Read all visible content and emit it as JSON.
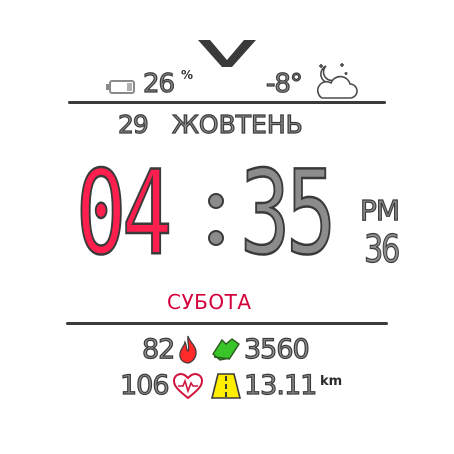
{
  "top": {
    "logo_icon": "w-logo-icon",
    "battery_percent": "26",
    "battery_unit": "%",
    "battery_icon": "battery-icon",
    "temperature": "-8°",
    "weather_icon": "night-cloudy-icon"
  },
  "date": {
    "day": "29",
    "month": "ЖОВТЕНЬ"
  },
  "time": {
    "hours": "04",
    "minutes": "35",
    "ampm": "PM",
    "seconds": "36"
  },
  "weekday": "СУБОТА",
  "stats": {
    "calories": "82",
    "calories_icon": "flame-icon",
    "steps": "3560",
    "steps_icon": "shoe-icon",
    "heart_rate": "106",
    "heart_icon": "heart-pulse-icon",
    "distance": "13.11",
    "distance_icon": "road-icon",
    "distance_unit": "km"
  },
  "colors": {
    "hours": "#ff1f4f",
    "minutes": "#8c8c8c",
    "weekday": "#d4003a",
    "flame": "#ff2a2a",
    "shoe": "#39c42a",
    "road": "#ffee00"
  }
}
